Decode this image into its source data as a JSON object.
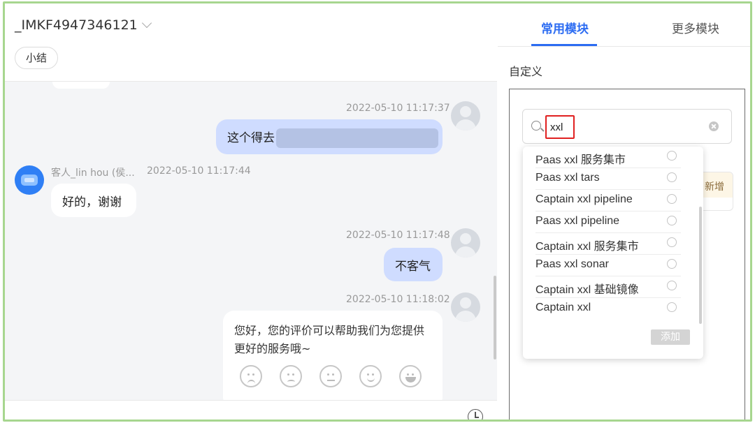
{
  "chat": {
    "session_id": "_IMKF4947346121",
    "summary_button": "小结",
    "messages": [
      {
        "timestamp": "2022-05-10 11:17:37",
        "text": "这个得去"
      },
      {
        "sender": "客人_lin hou (侯...",
        "timestamp": "2022-05-10 11:17:44",
        "text": "好的，谢谢"
      },
      {
        "timestamp": "2022-05-10 11:17:48",
        "text": "不客气"
      },
      {
        "timestamp": "2022-05-10 11:18:02",
        "text": "您好，您的评价可以帮助我们为您提供更好的服务哦~"
      }
    ],
    "rating_icons": [
      "angry-face-icon",
      "sad-face-icon",
      "neutral-face-icon",
      "happy-face-icon",
      "great-face-icon"
    ]
  },
  "sidebar": {
    "tabs": [
      {
        "label": "常用模块",
        "active": true
      },
      {
        "label": "更多模块",
        "active": false
      }
    ],
    "section_label": "自定义",
    "search": {
      "value": "xxl"
    },
    "behind_tag": "新增",
    "dropdown": {
      "items": [
        "Paas xxl 服务集市",
        "Paas xxl tars",
        "Captain xxl pipeline",
        "Paas xxl pipeline",
        "Captain xxl 服务集市",
        "Paas xxl sonar",
        "Captain xxl 基础镜像",
        "Captain xxl"
      ],
      "add_label": "添加"
    }
  },
  "colors": {
    "frame_border": "#a7d68f",
    "accent": "#2c6cf2",
    "my_bubble": "#cfdcff",
    "highlight_box": "#e02020"
  }
}
